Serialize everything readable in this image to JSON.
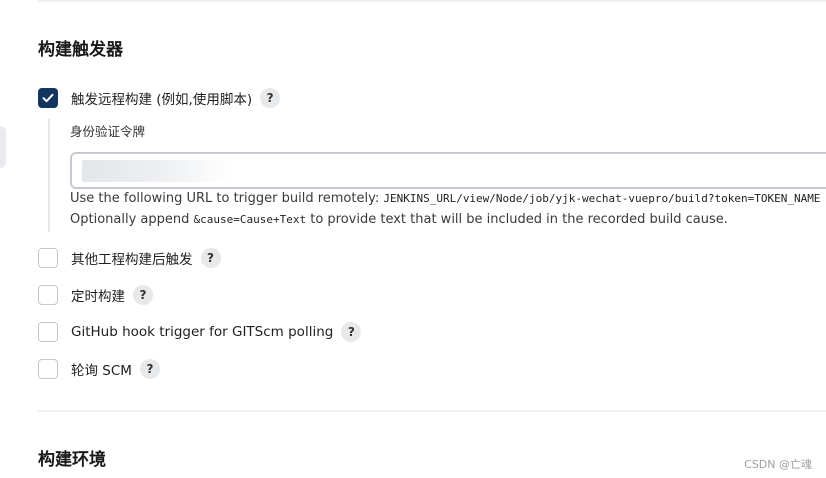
{
  "sections": {
    "build_triggers_title": "构建触发器",
    "build_env_title": "构建环境"
  },
  "triggers": [
    {
      "label": "触发远程构建 (例如,使用脚本)",
      "checked": true
    },
    {
      "label": "其他工程构建后触发",
      "checked": false
    },
    {
      "label": "定时构建",
      "checked": false
    },
    {
      "label": "GitHub hook trigger for GITScm polling",
      "checked": false
    },
    {
      "label": "轮询 SCM",
      "checked": false
    }
  ],
  "remote": {
    "token_label": "身份验证令牌",
    "url_prefix": "Use the following URL to trigger build remotely: ",
    "url_code": "JENKINS_URL/view/Node/job/yjk-wechat-vuepro/build?token=TOKEN_NAME",
    "append_prefix": "Optionally append ",
    "append_code": "&cause=Cause+Text",
    "append_suffix": " to provide text that will be included in the recorded build cause."
  },
  "help_glyph": "?",
  "watermark": "CSDN @亡魂",
  "colors": {
    "checked_fill": "#12365f",
    "checkbox_border": "#c3c7cf",
    "help_bg": "#e7e8ea"
  },
  "icons": {
    "check": "check-icon",
    "help": "help-icon"
  }
}
